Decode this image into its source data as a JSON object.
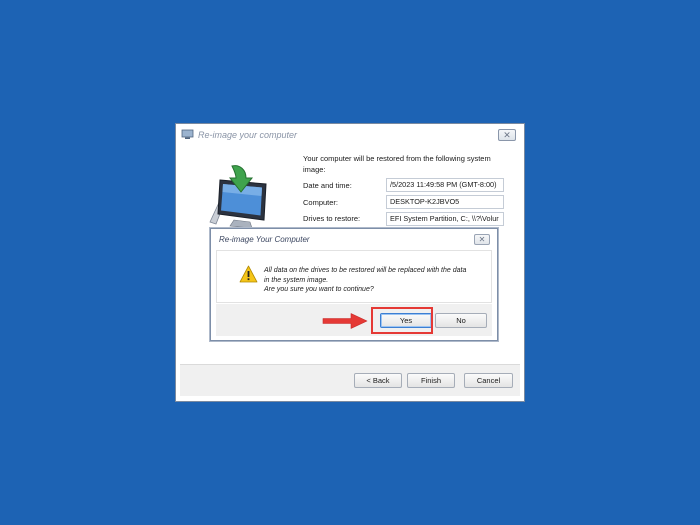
{
  "main_window": {
    "title": "Re-image your computer",
    "close_label": "✕",
    "intro": "Your computer will be restored from the following system image:",
    "details": [
      {
        "label": "Date and time:",
        "value": "/5/2023 11:49:58 PM (GMT-8:00)"
      },
      {
        "label": "Computer:",
        "value": "DESKTOP-K2JBVO5"
      },
      {
        "label": "Drives to restore:",
        "value": "EFI System Partition, C:, \\\\?\\Volur"
      }
    ],
    "buttons": {
      "back": "< Back",
      "finish": "Finish",
      "cancel": "Cancel"
    }
  },
  "confirm_dialog": {
    "title": "Re-image Your Computer",
    "close_label": "✕",
    "message_line1": "All data on the drives to be restored will be replaced with the data",
    "message_line2": "in the system image.",
    "message_line3": "Are you sure you want to continue?",
    "buttons": {
      "yes": "Yes",
      "no": "No"
    }
  },
  "colors": {
    "desktop": "#1d63b4",
    "highlight": "#e53935",
    "arrow": "#e53935",
    "warning": "#f5c518"
  },
  "icons": [
    "restore-computer-icon",
    "warning-icon",
    "arrow-pointer-icon"
  ]
}
